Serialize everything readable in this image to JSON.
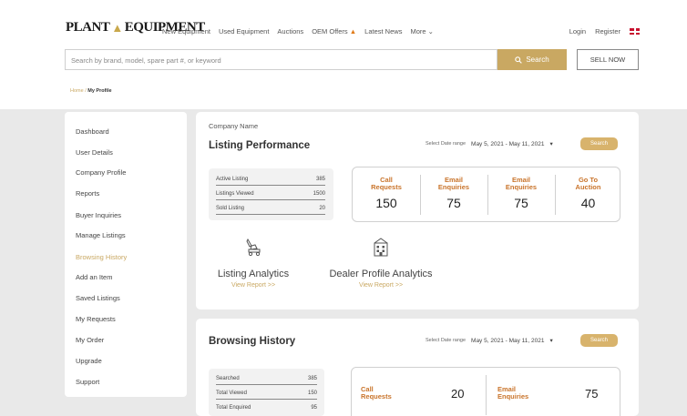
{
  "header": {
    "logo_left": "PLANT",
    "logo_right": "EQUIPMENT",
    "nav": [
      "New Equipment",
      "Used Equipment",
      "Auctions",
      "OEM Offers",
      "Latest News",
      "More"
    ],
    "login": "Login",
    "register": "Register"
  },
  "search": {
    "placeholder": "Search by brand, model, spare part #, or keyword",
    "button_label": "Search",
    "sell_label": "SELL NOW"
  },
  "breadcrumb": {
    "home": "Home",
    "current": "My Profile"
  },
  "sidebar": {
    "items": [
      {
        "label": "Dashboard"
      },
      {
        "label": "User Details"
      },
      {
        "label": "Company Profile"
      },
      {
        "label": "Reports"
      },
      {
        "label": "Buyer Inquiries"
      },
      {
        "label": "Manage Listings"
      },
      {
        "label": "Browsing History"
      },
      {
        "label": "Add an Item"
      },
      {
        "label": "Saved Listings"
      },
      {
        "label": "My Requests"
      },
      {
        "label": "My Order"
      },
      {
        "label": "Upgrade"
      },
      {
        "label": "Support"
      }
    ],
    "active": "Browsing History"
  },
  "listing_performance": {
    "company": "Company Name",
    "title": "Listing Performance",
    "date_label": "Select Date range",
    "date_value": "May 5, 2021 - May 11, 2021",
    "search_button": "Search",
    "stats": [
      {
        "label": "Active Listing",
        "value": "385"
      },
      {
        "label": "Listings Viewed",
        "value": "1500"
      },
      {
        "label": "Sold Listing",
        "value": "20"
      }
    ],
    "metrics": [
      {
        "label_1": "Call",
        "label_2": "Requests",
        "value": "150"
      },
      {
        "label_1": "Email",
        "label_2": "Enquiries",
        "value": "75"
      },
      {
        "label_1": "Email",
        "label_2": "Enquiries",
        "value": "75"
      },
      {
        "label_1": "Go To",
        "label_2": "Auction",
        "value": "40"
      }
    ],
    "analytics": [
      {
        "title": "Listing Analytics",
        "link": "View Report >>",
        "icon": "excavator-icon"
      },
      {
        "title": "Dealer Profile Analytics",
        "link": "View Report >>",
        "icon": "building-icon"
      }
    ]
  },
  "browsing_history": {
    "title": "Browsing History",
    "date_label": "Select Date range",
    "date_value": "May 5, 2021 - May 11, 2021",
    "search_button": "Search",
    "stats": [
      {
        "label": "Searched",
        "value": "385"
      },
      {
        "label": "Total Viewed",
        "value": "150"
      },
      {
        "label": "Total Enquired",
        "value": "95"
      }
    ],
    "metrics": [
      {
        "label_1": "Call",
        "label_2": "Requests",
        "value": "20"
      },
      {
        "label_1": "Email",
        "label_2": "Enquiries",
        "value": "75"
      }
    ]
  },
  "colors": {
    "accent": "#c9a862",
    "metric_label": "#c9742b",
    "background": "#e9e9e9"
  }
}
